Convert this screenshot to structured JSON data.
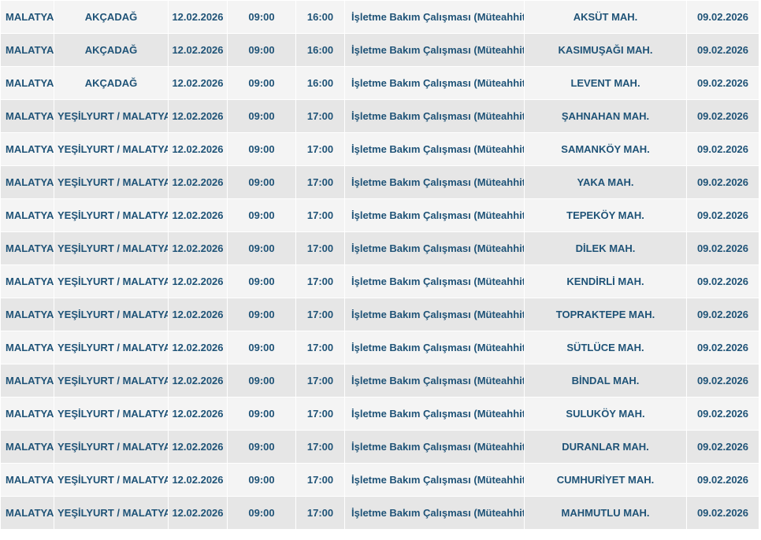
{
  "table": {
    "rows": [
      {
        "province": "MALATYA",
        "district": "AKÇADAĞ",
        "date": "12.02.2026",
        "start": "09:00",
        "end": "16:00",
        "reason": "İşletme Bakım Çalışması (Müteahhit)",
        "neighborhood": "AKSÜT MAH.",
        "announced": "09.02.2026"
      },
      {
        "province": "MALATYA",
        "district": "AKÇADAĞ",
        "date": "12.02.2026",
        "start": "09:00",
        "end": "16:00",
        "reason": "İşletme Bakım Çalışması (Müteahhit)",
        "neighborhood": "KASIMUŞAĞI MAH.",
        "announced": "09.02.2026"
      },
      {
        "province": "MALATYA",
        "district": "AKÇADAĞ",
        "date": "12.02.2026",
        "start": "09:00",
        "end": "16:00",
        "reason": "İşletme Bakım Çalışması (Müteahhit)",
        "neighborhood": "LEVENT MAH.",
        "announced": "09.02.2026"
      },
      {
        "province": "MALATYA",
        "district": "YEŞİLYURT / MALATYA",
        "date": "12.02.2026",
        "start": "09:00",
        "end": "17:00",
        "reason": "İşletme Bakım Çalışması (Müteahhit)",
        "neighborhood": "ŞAHNAHAN MAH.",
        "announced": "09.02.2026"
      },
      {
        "province": "MALATYA",
        "district": "YEŞİLYURT / MALATYA",
        "date": "12.02.2026",
        "start": "09:00",
        "end": "17:00",
        "reason": "İşletme Bakım Çalışması (Müteahhit)",
        "neighborhood": "SAMANKÖY MAH.",
        "announced": "09.02.2026"
      },
      {
        "province": "MALATYA",
        "district": "YEŞİLYURT / MALATYA",
        "date": "12.02.2026",
        "start": "09:00",
        "end": "17:00",
        "reason": "İşletme Bakım Çalışması (Müteahhit)",
        "neighborhood": "YAKA MAH.",
        "announced": "09.02.2026"
      },
      {
        "province": "MALATYA",
        "district": "YEŞİLYURT / MALATYA",
        "date": "12.02.2026",
        "start": "09:00",
        "end": "17:00",
        "reason": "İşletme Bakım Çalışması (Müteahhit)",
        "neighborhood": "TEPEKÖY MAH.",
        "announced": "09.02.2026"
      },
      {
        "province": "MALATYA",
        "district": "YEŞİLYURT / MALATYA",
        "date": "12.02.2026",
        "start": "09:00",
        "end": "17:00",
        "reason": "İşletme Bakım Çalışması (Müteahhit)",
        "neighborhood": "DİLEK MAH.",
        "announced": "09.02.2026"
      },
      {
        "province": "MALATYA",
        "district": "YEŞİLYURT / MALATYA",
        "date": "12.02.2026",
        "start": "09:00",
        "end": "17:00",
        "reason": "İşletme Bakım Çalışması (Müteahhit)",
        "neighborhood": "KENDİRLİ MAH.",
        "announced": "09.02.2026"
      },
      {
        "province": "MALATYA",
        "district": "YEŞİLYURT / MALATYA",
        "date": "12.02.2026",
        "start": "09:00",
        "end": "17:00",
        "reason": "İşletme Bakım Çalışması (Müteahhit)",
        "neighborhood": "TOPRAKTEPE MAH.",
        "announced": "09.02.2026"
      },
      {
        "province": "MALATYA",
        "district": "YEŞİLYURT / MALATYA",
        "date": "12.02.2026",
        "start": "09:00",
        "end": "17:00",
        "reason": "İşletme Bakım Çalışması (Müteahhit)",
        "neighborhood": "SÜTLÜCE MAH.",
        "announced": "09.02.2026"
      },
      {
        "province": "MALATYA",
        "district": "YEŞİLYURT / MALATYA",
        "date": "12.02.2026",
        "start": "09:00",
        "end": "17:00",
        "reason": "İşletme Bakım Çalışması (Müteahhit)",
        "neighborhood": "BİNDAL MAH.",
        "announced": "09.02.2026"
      },
      {
        "province": "MALATYA",
        "district": "YEŞİLYURT / MALATYA",
        "date": "12.02.2026",
        "start": "09:00",
        "end": "17:00",
        "reason": "İşletme Bakım Çalışması (Müteahhit)",
        "neighborhood": "SULUKÖY MAH.",
        "announced": "09.02.2026"
      },
      {
        "province": "MALATYA",
        "district": "YEŞİLYURT / MALATYA",
        "date": "12.02.2026",
        "start": "09:00",
        "end": "17:00",
        "reason": "İşletme Bakım Çalışması (Müteahhit)",
        "neighborhood": "DURANLAR MAH.",
        "announced": "09.02.2026"
      },
      {
        "province": "MALATYA",
        "district": "YEŞİLYURT / MALATYA",
        "date": "12.02.2026",
        "start": "09:00",
        "end": "17:00",
        "reason": "İşletme Bakım Çalışması (Müteahhit)",
        "neighborhood": "CUMHURİYET MAH.",
        "announced": "09.02.2026"
      },
      {
        "province": "MALATYA",
        "district": "YEŞİLYURT / MALATYA",
        "date": "12.02.2026",
        "start": "09:00",
        "end": "17:00",
        "reason": "İşletme Bakım Çalışması (Müteahhit)",
        "neighborhood": "MAHMUTLU MAH.",
        "announced": "09.02.2026"
      }
    ]
  },
  "colors": {
    "text": "#1f5377",
    "row_light": "#f4f4f4",
    "row_dark": "#e6e6e6"
  }
}
